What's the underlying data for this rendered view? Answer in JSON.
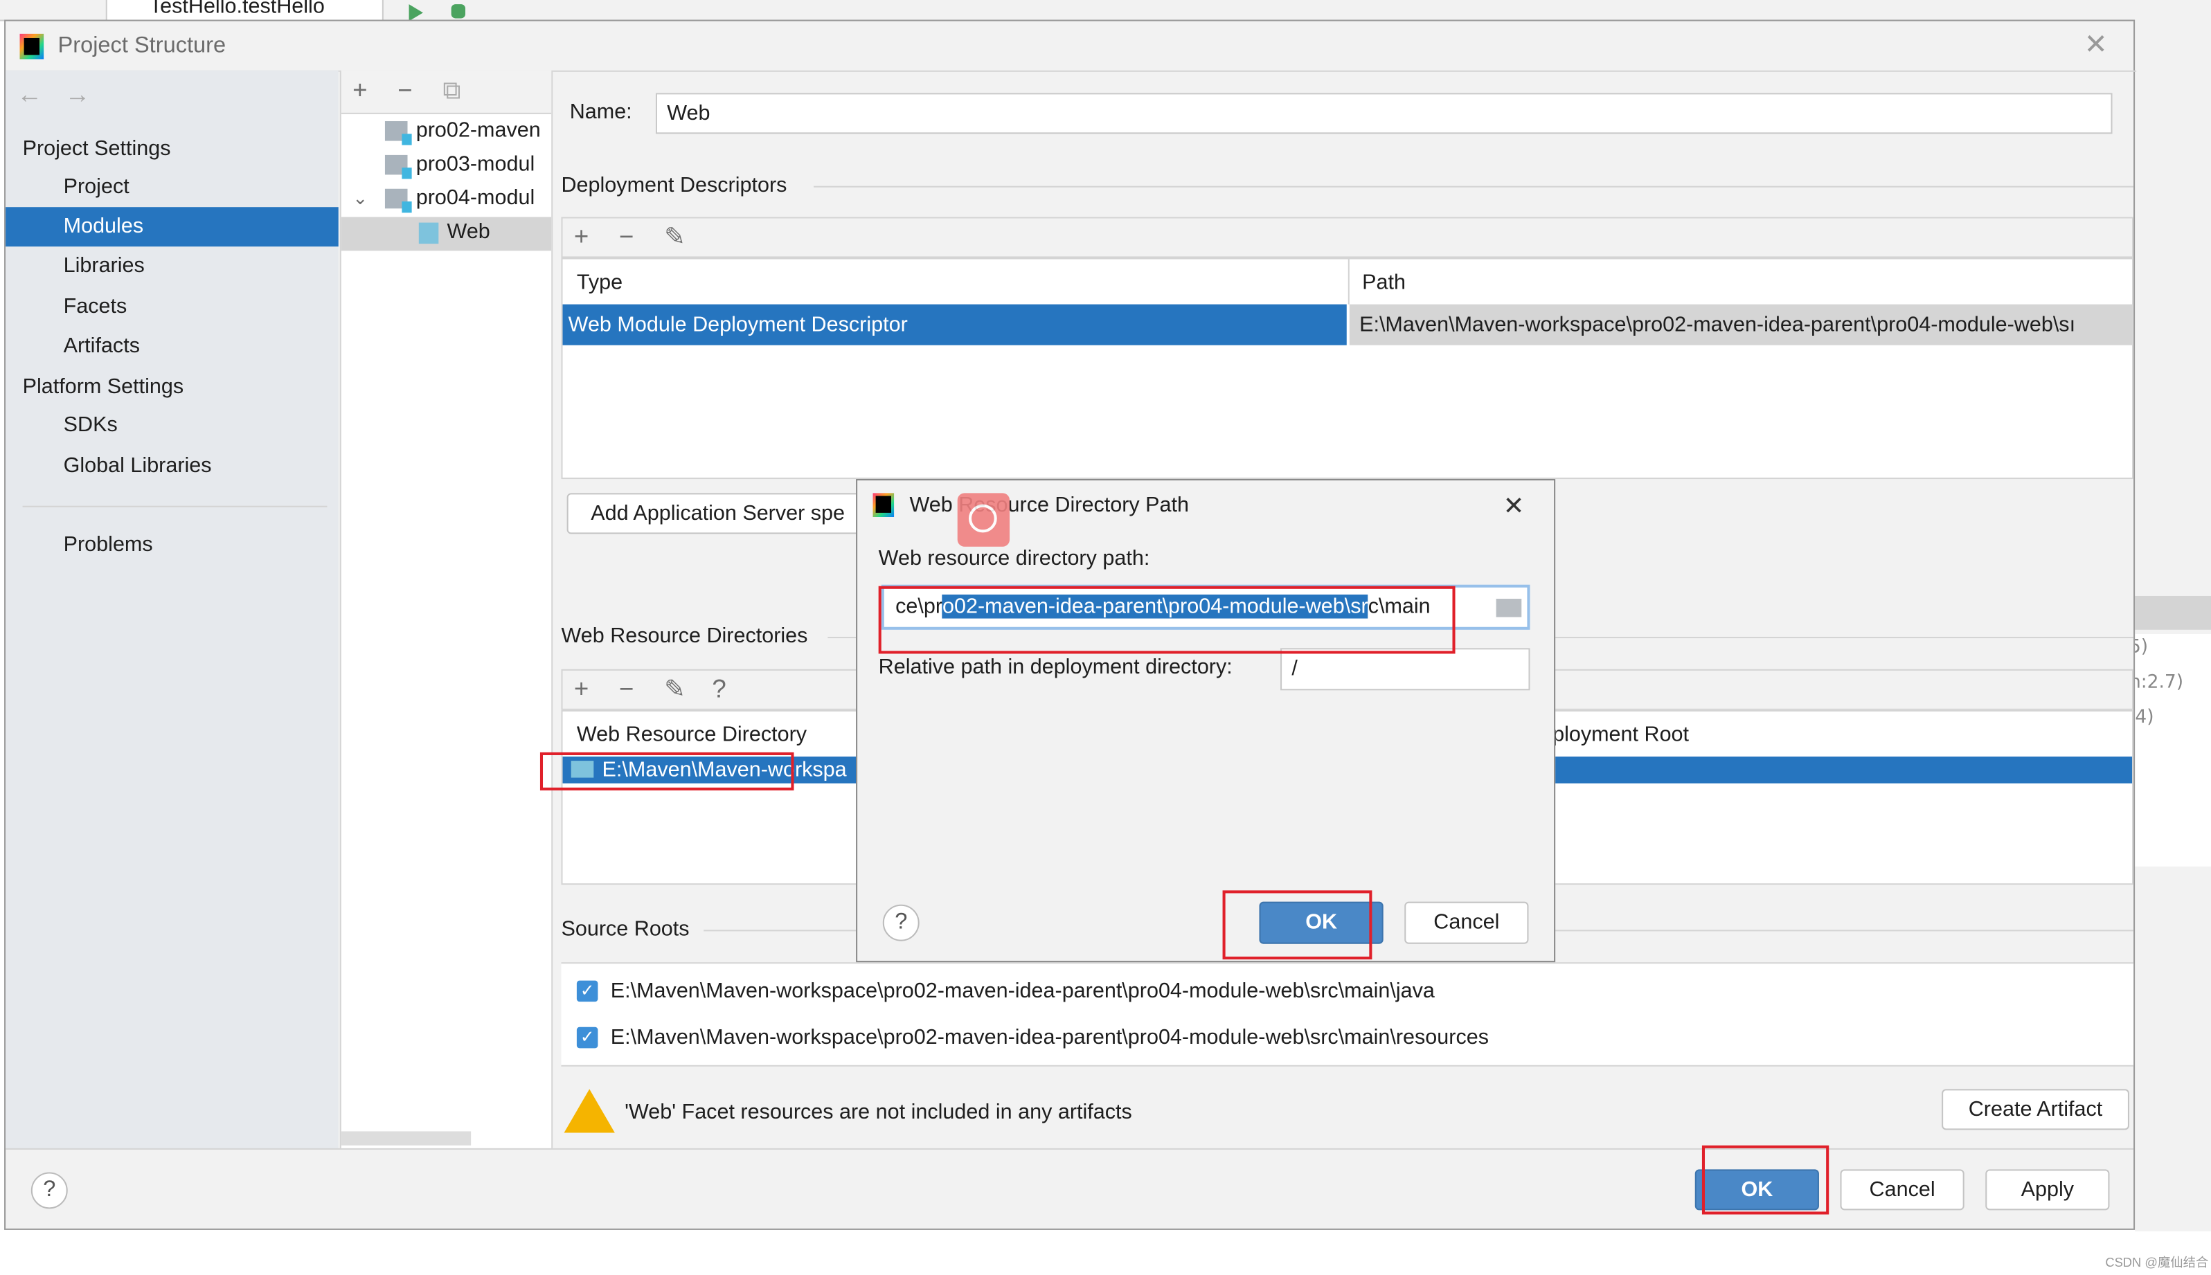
{
  "ide": {
    "run_config": "TestHello.testHello",
    "behind_fragments": [
      "5)",
      "n:2.7)",
      ".4)"
    ]
  },
  "dialog": {
    "title": "Project Structure"
  },
  "sidebar": {
    "project_settings": "Project Settings",
    "items": [
      {
        "label": "Project"
      },
      {
        "label": "Modules",
        "selected": true
      },
      {
        "label": "Libraries"
      },
      {
        "label": "Facets"
      },
      {
        "label": "Artifacts"
      }
    ],
    "platform_settings": "Platform Settings",
    "platform_items": [
      {
        "label": "SDKs"
      },
      {
        "label": "Global Libraries"
      }
    ],
    "problems": "Problems"
  },
  "tree": {
    "items": [
      {
        "label": "pro02-maven"
      },
      {
        "label": "pro03-modul"
      },
      {
        "label": "pro04-modul",
        "expanded": true
      },
      {
        "label": "Web",
        "selected": true
      }
    ]
  },
  "main": {
    "name_label": "Name:",
    "name_value": "Web",
    "deployment_descriptors": "Deployment Descriptors",
    "dd_columns": [
      "Type",
      "Path"
    ],
    "dd_row": [
      "Web Module Deployment Descriptor",
      "E:\\Maven\\Maven-workspace\\pro02-maven-idea-parent\\pro04-module-web\\sı"
    ],
    "add_server_button": "Add Application Server spe",
    "web_resource_directories": "Web Resource Directories",
    "wrd_columns": [
      "Web Resource Directory",
      "ployment Root"
    ],
    "wrd_row": "E:\\Maven\\Maven-workspa",
    "source_roots": "Source Roots",
    "source_root_items": [
      "E:\\Maven\\Maven-workspace\\pro02-maven-idea-parent\\pro04-module-web\\src\\main\\java",
      "E:\\Maven\\Maven-workspace\\pro02-maven-idea-parent\\pro04-module-web\\src\\main\\resources"
    ],
    "warning": "'Web' Facet resources are not included in any artifacts",
    "create_artifact": "Create Artifact"
  },
  "footer": {
    "ok": "OK",
    "cancel": "Cancel",
    "apply": "Apply",
    "help": "?"
  },
  "inner_dialog": {
    "title": "Web Resource Directory Path",
    "path_label": "Web resource directory path:",
    "path_before": "ce\\pr",
    "path_selected": "o02-maven-idea-parent\\pro04-module-web\\sr",
    "path_after": "c\\main",
    "relative_label": "Relative path in deployment directory:",
    "relative_value": "/",
    "ok": "OK",
    "cancel": "Cancel",
    "help": "?"
  },
  "watermark": "CSDN @魔仙结合",
  "colors": {
    "selection": "#2675bf",
    "annotation": "#e0202a",
    "primary_button": "#4a88c7"
  }
}
